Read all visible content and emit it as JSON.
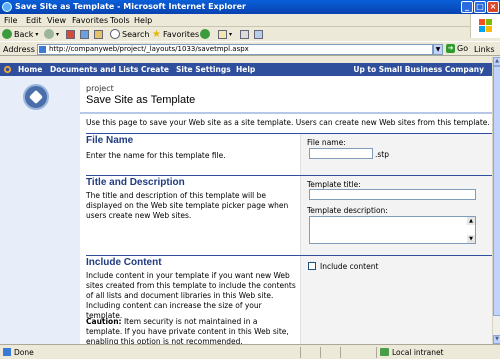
{
  "window": {
    "title": "Save Site as Template - Microsoft Internet Explorer"
  },
  "menu": [
    "File",
    "Edit",
    "View",
    "Favorites",
    "Tools",
    "Help"
  ],
  "toolbar": {
    "back_label": "Back",
    "search_label": "Search",
    "favorites_label": "Favorites"
  },
  "address": {
    "label": "Address",
    "url": "http://companyweb/project/_layouts/1033/savetmpl.aspx",
    "go_label": "Go",
    "links_label": "Links"
  },
  "spnav": {
    "items": [
      "Home",
      "Documents and Lists",
      "Create",
      "Site Settings",
      "Help"
    ],
    "up_label": "Up to Small Business Company"
  },
  "page": {
    "breadcrumb": "project",
    "title": "Save Site as Template",
    "intro": "Use this page to save your Web site as a site template. Users can create new Web sites from this template."
  },
  "sections": {
    "file_name": {
      "heading": "File Name",
      "description": "Enter the name for this template file.",
      "field_label": "File name:",
      "field_value": "",
      "suffix": ".stp"
    },
    "title_desc": {
      "heading": "Title and Description",
      "description": "The title and description of this template will be displayed on the Web site template picker page when users create new Web sites.",
      "title_label": "Template title:",
      "title_value": "",
      "desc_label": "Template description:",
      "desc_value": ""
    },
    "include": {
      "heading": "Include Content",
      "description": "Include content in your template if you want new Web sites created from this template to include the contents of all lists and document libraries in this Web site. Including content can increase the size of your template.",
      "caution_label": "Caution:",
      "caution_text": " Item security is not maintained in a template. If you have private content in this Web site, enabling this option is not recommended.",
      "checkbox_label": "Include content",
      "checked": false
    }
  },
  "status": {
    "text": "Done",
    "zone": "Local intranet"
  },
  "colors": {
    "nav": "#2f4f9c",
    "heading": "#1f3b80",
    "leftpanel": "#e8eef9"
  }
}
